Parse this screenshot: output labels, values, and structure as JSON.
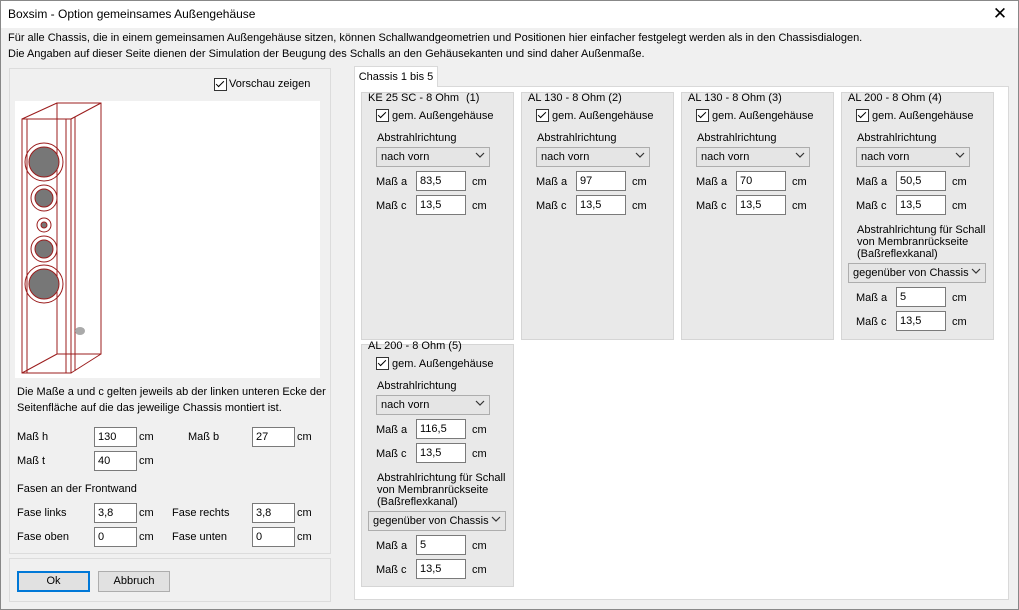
{
  "window": {
    "title": "Boxsim - Option gemeinsames Außengehäuse",
    "close_glyph": "✕"
  },
  "info": {
    "line1": "Für alle Chassis, die in einem gemeinsamen Außengehäuse sitzen, können Schallwandgeometrien und Positionen hier einfacher festgelegt werden als in den Chassisdialogen.",
    "line2": "Die Angaben auf dieser Seite dienen der Simulation der  Beugung des Schalls an den Gehäusekanten und sind daher Außenmaße."
  },
  "left": {
    "preview_label": "Vorschau zeigen",
    "note1": "Die Maße a und c gelten jeweils ab der linken unteren Ecke der",
    "note2": "Seitenfläche auf die das jeweilige Chassis montiert ist.",
    "mass_h_label": "Maß h",
    "mass_h": "130",
    "mass_b_label": "Maß b",
    "mass_b": "27",
    "mass_t_label": "Maß t",
    "mass_t": "40",
    "unit": "cm",
    "fasen_title": "Fasen an der Frontwand",
    "fase_links_label": "Fase links",
    "fase_links": "3,8",
    "fase_rechts_label": "Fase rechts",
    "fase_rechts": "3,8",
    "fase_oben_label": "Fase oben",
    "fase_oben": "0",
    "fase_unten_label": "Fase unten",
    "fase_unten": "0"
  },
  "buttons": {
    "ok": "Ok",
    "cancel": "Abbruch"
  },
  "tab": {
    "label": "Chassis 1 bis 5"
  },
  "common": {
    "gem_label": "gem. Außengehäuse",
    "abstrahl_label": "Abstrahlrichtung",
    "direction": "nach vorn",
    "mass_a_label": "Maß a",
    "mass_c_label": "Maß c",
    "unit": "cm",
    "rear_label1": "Abstrahlrichtung für Schall",
    "rear_label2": "von Membranrückseite",
    "rear_label3": "(Baßreflexkanal)",
    "rear_direction": "gegenüber von Chassis"
  },
  "chassis": [
    {
      "name": "KE 25 SC - 8 Ohm",
      "index": "(1)",
      "a": "83,5",
      "c": "13,5"
    },
    {
      "name": "AL 130 - 8 Ohm (2)",
      "a": "97",
      "c": "13,5"
    },
    {
      "name": "AL 130 - 8 Ohm (3)",
      "a": "70",
      "c": "13,5"
    },
    {
      "name": "AL 200 - 8 Ohm (4)",
      "a": "50,5",
      "c": "13,5",
      "rear_a": "5",
      "rear_c": "13,5"
    },
    {
      "name": "AL 200 - 8 Ohm (5)",
      "a": "116,5",
      "c": "13,5",
      "rear_a": "5",
      "rear_c": "13,5"
    }
  ]
}
